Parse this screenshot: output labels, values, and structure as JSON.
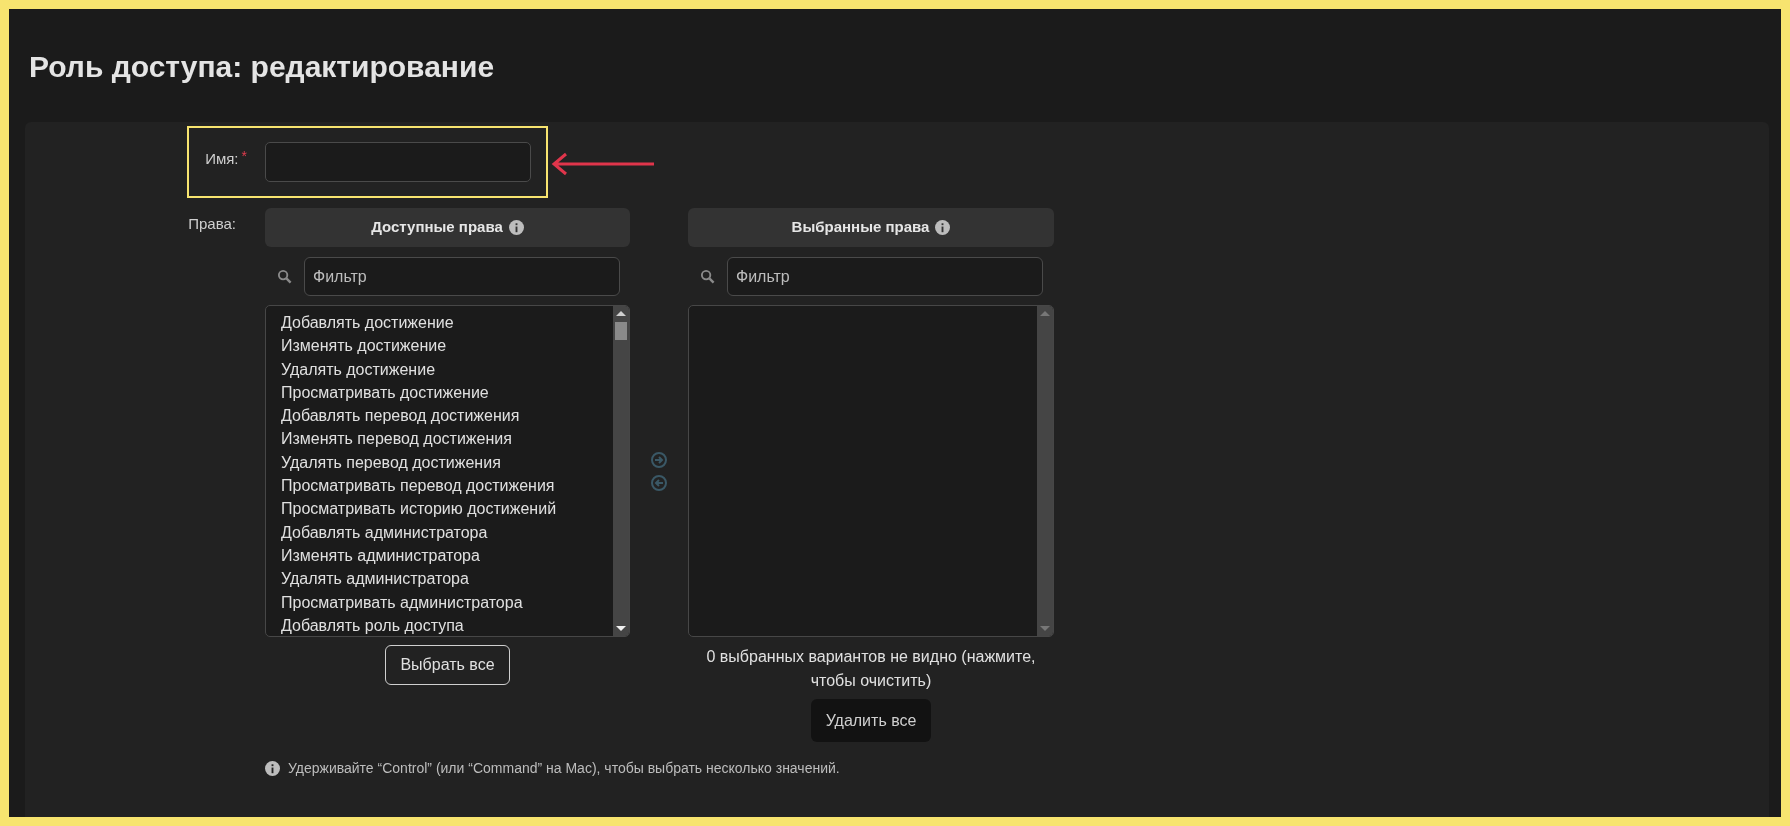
{
  "title": "Роль доступа: редактирование",
  "name_field": {
    "label": "Имя:",
    "required": true,
    "required_marker": "*"
  },
  "rights": {
    "label": "Права:",
    "available": {
      "title": "Доступные права",
      "filter_placeholder": "Фильтр",
      "items": [
        "Добавлять достижение",
        "Изменять достижение",
        "Удалять достижение",
        "Просматривать достижение",
        "Добавлять перевод достижения",
        "Изменять перевод достижения",
        "Удалять перевод достижения",
        "Просматривать перевод достижения",
        "Просматривать историю достижений",
        "Добавлять администратора",
        "Изменять администратора",
        "Удалять администратора",
        "Просматривать администратора",
        "Добавлять роль доступа"
      ],
      "button": "Выбрать все"
    },
    "chosen": {
      "title": "Выбранные права",
      "filter_placeholder": "Фильтр",
      "hidden_note": "0 выбранных вариантов не видно (нажмите, чтобы очистить)",
      "button": "Удалить все"
    },
    "help": "Удерживайте “Control” (или “Command” на Mac), чтобы выбрать несколько значений."
  }
}
